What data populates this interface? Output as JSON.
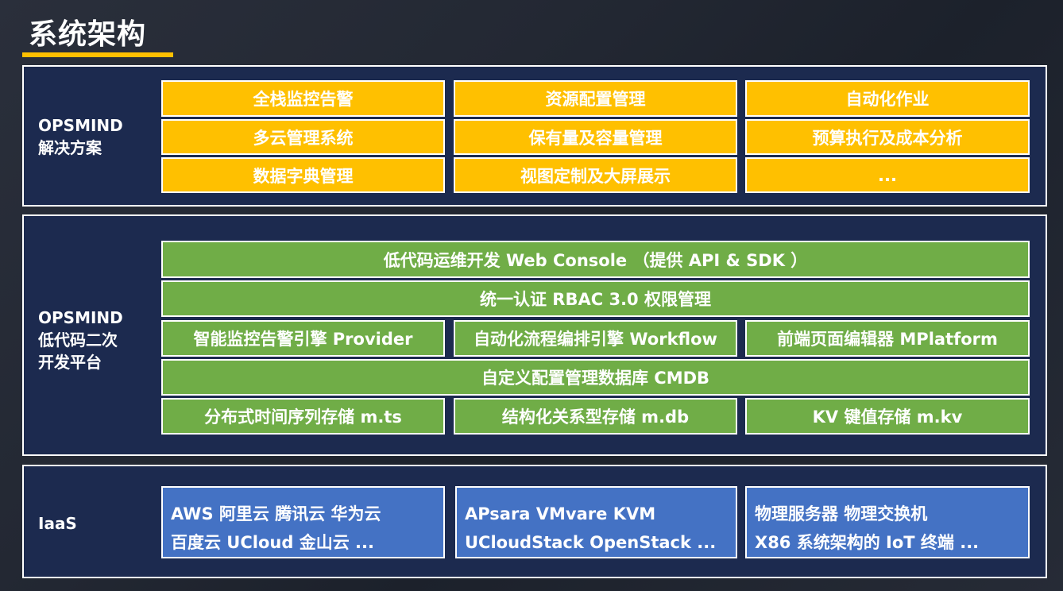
{
  "title": "系统架构",
  "colors": {
    "accent": "#ffc000",
    "solution_block": "#ffc000",
    "platform_block": "#70ad47",
    "iaas_block": "#4472c4",
    "panel_bg": "#1c2a4f"
  },
  "solution": {
    "label_line1": "OPSMIND",
    "label_line2": "解决方案",
    "items": [
      "全栈监控告警",
      "资源配置管理",
      "自动化作业",
      "多云管理系统",
      "保有量及容量管理",
      "预算执行及成本分析",
      "数据字典管理",
      "视图定制及大屏展示",
      "..."
    ]
  },
  "platform": {
    "label_line1": "OPSMIND",
    "label_line2": "低代码二次",
    "label_line3": "开发平台",
    "console": "低代码运维开发 Web Console （提供 API  & SDK ）",
    "auth": "统一认证 RBAC 3.0 权限管理",
    "engines": [
      "智能监控告警引擎  Provider",
      "自动化流程编排引擎  Workflow",
      "前端页面编辑器 MPlatform"
    ],
    "cmdb": "自定义配置管理数据库 CMDB",
    "storage": [
      "分布式时间序列存储  m.ts",
      "结构化关系型存储   m.db",
      "KV 键值存储  m.kv"
    ]
  },
  "iaas": {
    "label": "IaaS",
    "boxes": [
      {
        "line1": "AWS  阿里云  腾讯云  华为云",
        "line2": "百度云  UCloud  金山云  ..."
      },
      {
        "line1": "APsara  VMvare  KVM",
        "line2": "UCloudStack  OpenStack  ..."
      },
      {
        "line1": "物理服务器  物理交换机",
        "line2": "X86 系统架构的 IoT 终端  ..."
      }
    ]
  }
}
